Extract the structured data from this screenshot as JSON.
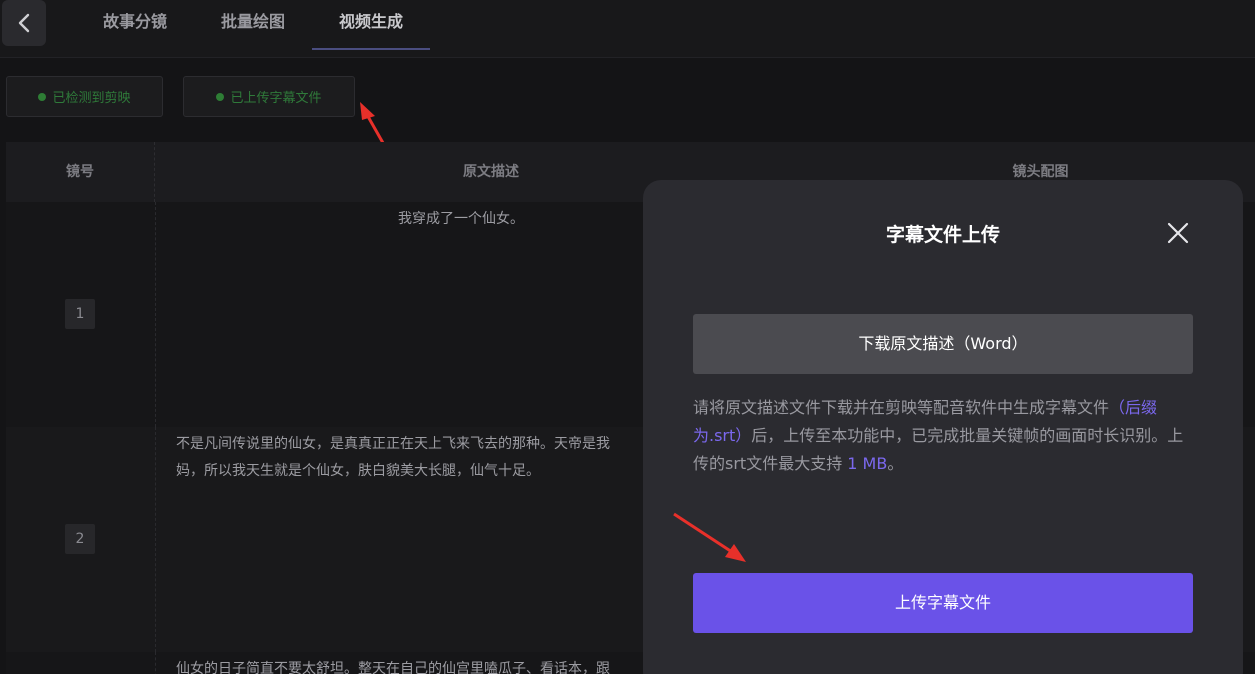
{
  "tabs": [
    {
      "label": "故事分镜"
    },
    {
      "label": "批量绘图"
    },
    {
      "label": "视频生成"
    }
  ],
  "status": {
    "capcut": "已检测到剪映",
    "subtitle": "已上传字幕文件"
  },
  "table": {
    "headers": [
      "镜号",
      "原文描述",
      "镜头配图"
    ],
    "rows": [
      {
        "no": "1",
        "desc": "我穿成了一个仙女。"
      },
      {
        "no": "2",
        "desc": "不是凡间传说里的仙女，是真真正正在天上飞来飞去的那种。天帝是我\n妈，所以我天生就是个仙女，肤白貌美大长腿，仙气十足。"
      },
      {
        "no": "",
        "desc": "仙女的日子简直不要太舒坦。整天在自己的仙宫里嗑瓜子、看话本，跟"
      }
    ]
  },
  "modal": {
    "title": "字幕文件上传",
    "download_label": "下载原文描述（Word）",
    "hint_part1": "请将原文描述文件下载并在剪映等配音软件中生成字幕文件",
    "hint_accent1": "（后缀为.srt）",
    "hint_part2": "后，上传至本功能中，已完成批量关键帧的画面时长识别。上传的srt文件最大支持 ",
    "hint_accent2": "1 MB",
    "hint_part3": "。",
    "upload_label": "上传字幕文件"
  },
  "colors": {
    "accent": "#6a52e8",
    "status_green": "#2e7d35",
    "annotation_arrow": "#e8302a"
  },
  "icons": [
    "chevron-left-icon",
    "close-icon",
    "status-dot-icon"
  ]
}
